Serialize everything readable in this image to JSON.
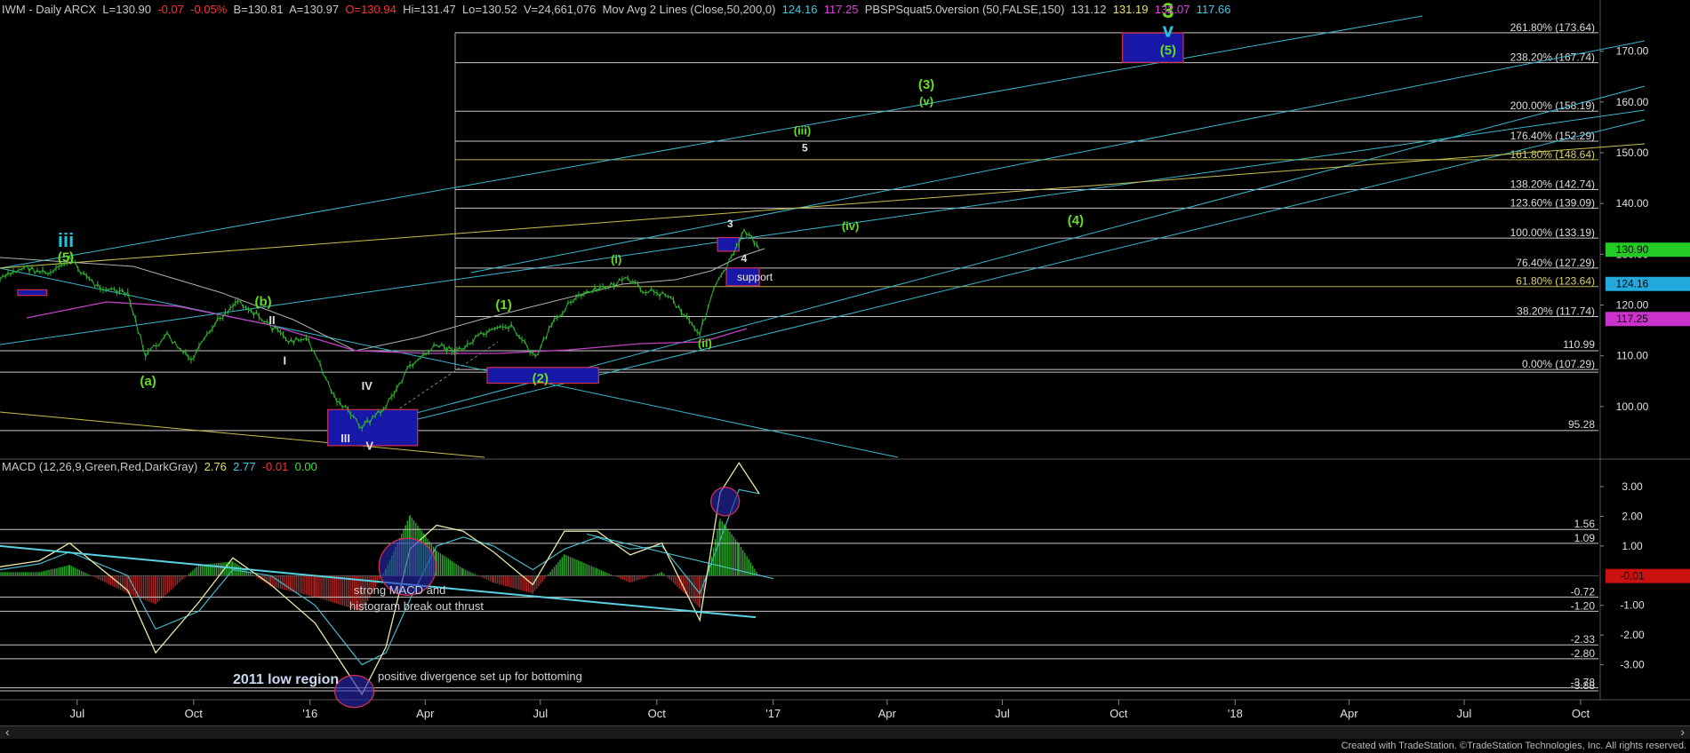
{
  "header": {
    "symbol": "IWM - Daily ARCX",
    "last": "L=130.90",
    "chg": "-0.07",
    "chg_pct": "-0.05%",
    "bid": "B=130.81",
    "ask": "A=130.97",
    "open": "O=130.94",
    "hi": "Hi=131.47",
    "lo": "Lo=130.52",
    "vol": "V=24,661,076",
    "ma_label": "Mov Avg 2 Lines (Close,50,200,0)",
    "ma1": "124.16",
    "ma2": "117.25",
    "pbsp_label": "PBSPSquat5.0version (50,FALSE,150)",
    "pbsp1": "131.12",
    "pbsp2": "131.19",
    "pbsp3": "132.07",
    "pbsp4": "117.66"
  },
  "macd_header": {
    "label": "MACD (12,26,9,Green,Red,DarkGray)",
    "v1": "2.76",
    "v2": "2.77",
    "v3": "-0.01",
    "v4": "0.00"
  },
  "footer": "Created with TradeStation. ©TradeStation Technologies, Inc. All rights reserved.",
  "colors": {
    "price": "#2db52d",
    "cyan": "#38b8cc",
    "yellow": "#c8c04a",
    "magenta": "#c040c0",
    "count_green": "#66dd22",
    "count_cyan": "#22c4e0",
    "box_fill": "#1818a8",
    "macd_line": "#e8e8a8",
    "signal_line": "#48b8c8",
    "hist_pos": "#27a827",
    "hist_neg": "#a82727"
  },
  "chart_data": {
    "type": "line",
    "title": "IWM - Daily ARCX",
    "x_tick_labels": [
      "Jul",
      "Oct",
      "'16",
      "Apr",
      "Jul",
      "Oct",
      "'17",
      "Apr",
      "Jul",
      "Oct",
      "'18",
      "Apr",
      "Jul",
      "Oct"
    ],
    "price_axis": {
      "range": [
        90,
        178
      ],
      "ticks": [
        100,
        110,
        120,
        130,
        140,
        150,
        160,
        170
      ]
    },
    "macd_axis": {
      "range": [
        -4.0,
        3.9
      ],
      "ticks": [
        3.0,
        2.0,
        1.0,
        -1.0,
        -2.0,
        -3.0
      ]
    },
    "price_series": {
      "name": "IWM",
      "x": [
        "2015-05-01",
        "2015-05-20",
        "2015-06-10",
        "2015-06-25",
        "2015-07-15",
        "2015-08-10",
        "2015-08-24",
        "2015-09-10",
        "2015-09-29",
        "2015-10-20",
        "2015-11-05",
        "2015-11-30",
        "2015-12-15",
        "2015-12-31",
        "2016-01-20",
        "2016-02-11",
        "2016-03-01",
        "2016-03-20",
        "2016-04-10",
        "2016-04-28",
        "2016-05-15",
        "2016-06-08",
        "2016-06-27",
        "2016-07-10",
        "2016-07-25",
        "2016-08-15",
        "2016-09-08",
        "2016-09-20",
        "2016-10-10",
        "2016-11-04",
        "2016-11-15",
        "2016-12-01",
        "2016-12-09",
        "2016-12-21"
      ],
      "y": [
        125,
        127.5,
        126,
        129,
        124,
        122,
        110,
        114,
        109,
        117,
        121,
        116,
        113,
        113,
        102,
        96,
        100,
        108,
        112,
        111,
        114,
        116,
        109.5,
        116,
        121,
        123,
        125,
        123,
        122,
        114.5,
        123,
        130,
        135,
        130.9
      ]
    },
    "moving_averages": [
      {
        "name": "50-day",
        "last": 124.16
      },
      {
        "name": "200-day",
        "last": 117.25
      }
    ],
    "fib_levels": [
      {
        "label": "261.80%",
        "value": 173.64
      },
      {
        "label": "238.20%",
        "value": 167.74
      },
      {
        "label": "200.00%",
        "value": 158.19
      },
      {
        "label": "176.40%",
        "value": 152.29
      },
      {
        "label": "161.80%",
        "value": 148.64
      },
      {
        "label": "138.20%",
        "value": 142.74
      },
      {
        "label": "123.60%",
        "value": 139.09
      },
      {
        "label": "100.00%",
        "value": 133.19
      },
      {
        "label": "76.40%",
        "value": 127.29
      },
      {
        "label": "61.80%",
        "value": 123.64
      },
      {
        "label": "38.20%",
        "value": 117.74
      },
      {
        "label": "0.00%",
        "value": 107.29
      }
    ],
    "price_level_labels": [
      "110.99",
      "95.28"
    ],
    "price_badges": [
      {
        "value": "130.90",
        "color": "#22cc22"
      },
      {
        "value": "124.16",
        "color": "#22aadd"
      },
      {
        "value": "117.25",
        "color": "#cc33cc"
      }
    ],
    "wave_labels": [
      {
        "text": "iii",
        "date": "2015-06-22",
        "price": 131.5,
        "color": "cyan",
        "size": 22
      },
      {
        "text": "(5)",
        "date": "2015-06-22",
        "price": 128.6,
        "color": "green",
        "size": 15
      },
      {
        "text": "(a)",
        "date": "2015-08-26",
        "price": 104.2,
        "color": "green",
        "size": 15
      },
      {
        "text": "(b)",
        "date": "2015-11-25",
        "price": 119.8,
        "color": "green",
        "size": 15
      },
      {
        "text": "II",
        "date": "2015-12-02",
        "price": 116.2,
        "color": "white",
        "size": 13
      },
      {
        "text": "I",
        "date": "2015-12-12",
        "price": 108.3,
        "color": "white",
        "size": 13
      },
      {
        "text": "IV",
        "date": "2016-02-15",
        "price": 103.3,
        "color": "white",
        "size": 13
      },
      {
        "text": "III",
        "date": "2016-01-29",
        "price": 93.0,
        "color": "white",
        "size": 13
      },
      {
        "text": "V",
        "date": "2016-02-17",
        "price": 91.5,
        "color": "white",
        "size": 13
      },
      {
        "text": "(1)",
        "date": "2016-06-02",
        "price": 119.2,
        "color": "green",
        "size": 15
      },
      {
        "text": "(2)",
        "date": "2016-07-01",
        "price": 104.7,
        "color": "green",
        "size": 15
      },
      {
        "text": "(i)",
        "date": "2016-08-30",
        "price": 128.2,
        "color": "green",
        "size": 13
      },
      {
        "text": "(ii)",
        "date": "2016-11-08",
        "price": 111.7,
        "color": "green",
        "size": 13
      },
      {
        "text": "3",
        "date": "2016-11-28",
        "price": 135.3,
        "color": "white",
        "size": 12
      },
      {
        "text": "4",
        "date": "2016-12-09",
        "price": 128.5,
        "color": "white",
        "size": 12
      },
      {
        "text": "(iii)",
        "date": "2017-01-24",
        "price": 153.6,
        "color": "green",
        "size": 13
      },
      {
        "text": "5",
        "date": "2017-01-26",
        "price": 150.3,
        "color": "white",
        "size": 12
      },
      {
        "text": "(iv)",
        "date": "2017-03-03",
        "price": 134.8,
        "color": "green",
        "size": 13
      },
      {
        "text": "(3)",
        "date": "2017-05-02",
        "price": 162.6,
        "color": "green",
        "size": 15
      },
      {
        "text": "(v)",
        "date": "2017-05-02",
        "price": 159.4,
        "color": "green",
        "size": 13
      },
      {
        "text": "(4)",
        "date": "2017-08-28",
        "price": 135.8,
        "color": "green",
        "size": 15
      },
      {
        "text": "3",
        "date": "2017-11-09",
        "price": 176.6,
        "color": "green",
        "size": 24
      },
      {
        "text": "v",
        "date": "2017-11-09",
        "price": 172.8,
        "color": "cyan",
        "size": 22
      },
      {
        "text": "(5)",
        "date": "2017-11-09",
        "price": 169.3,
        "color": "green",
        "size": 15
      }
    ],
    "boxes": [
      {
        "date_from": "2015-05-15",
        "date_to": "2015-06-07",
        "price_top": 123.0,
        "price_bottom": 121.9,
        "label": ""
      },
      {
        "date_from": "2016-01-15",
        "date_to": "2016-03-26",
        "price_top": 99.4,
        "price_bottom": 92.3,
        "label": ""
      },
      {
        "date_from": "2016-05-20",
        "date_to": "2016-08-16",
        "price_top": 107.7,
        "price_bottom": 104.6,
        "label": ""
      },
      {
        "date_from": "2016-11-18",
        "date_to": "2016-12-05",
        "price_top": 133.3,
        "price_bottom": 130.6,
        "label": ""
      },
      {
        "date_from": "2016-11-25",
        "date_to": "2016-12-21",
        "price_top": 127.3,
        "price_bottom": 123.8,
        "label": "support"
      },
      {
        "date_from": "2017-10-04",
        "date_to": "2017-11-21",
        "price_top": 173.6,
        "price_bottom": 167.8,
        "label": ""
      }
    ],
    "macd": {
      "name": "MACD (12,26,9,Green,Red,DarkGray)",
      "x": [
        "2015-05-01",
        "2015-06-01",
        "2015-06-25",
        "2015-08-10",
        "2015-09-01",
        "2015-10-05",
        "2015-11-01",
        "2015-12-01",
        "2016-01-05",
        "2016-02-11",
        "2016-03-01",
        "2016-03-20",
        "2016-04-10",
        "2016-05-01",
        "2016-05-25",
        "2016-06-25",
        "2016-07-20",
        "2016-08-15",
        "2016-09-10",
        "2016-10-05",
        "2016-11-04",
        "2016-11-20",
        "2016-12-05",
        "2016-12-21"
      ],
      "macd": [
        0.3,
        0.5,
        1.1,
        -0.5,
        -2.6,
        -0.9,
        0.6,
        -0.3,
        -1.6,
        -4.0,
        -2.4,
        0.9,
        1.7,
        1.5,
        0.8,
        -0.3,
        1.5,
        1.5,
        0.7,
        1.1,
        -1.5,
        2.8,
        3.8,
        2.76
      ],
      "signal": [
        0.2,
        0.4,
        0.8,
        0.0,
        -1.8,
        -1.2,
        0.2,
        0.0,
        -1.0,
        -3.0,
        -2.6,
        -0.8,
        1.0,
        1.3,
        1.0,
        0.2,
        0.9,
        1.3,
        0.9,
        1.0,
        -0.6,
        1.2,
        2.9,
        2.77
      ],
      "level_labels": [
        "1.56",
        "1.09",
        "-0.72",
        "-1.20",
        "-2.33",
        "-2.80",
        "-3.78",
        "-3.88"
      ],
      "circles": [
        {
          "date": "2016-03-18",
          "value": 0.3
        },
        {
          "date": "2016-11-24",
          "value": 2.5
        },
        {
          "date": "2016-02-05",
          "value": -3.9
        }
      ]
    },
    "annotations": [
      "strong MACD  and",
      "histogram break out thrust",
      "2011 low region",
      "positive divergence set up for bottoming"
    ]
  }
}
